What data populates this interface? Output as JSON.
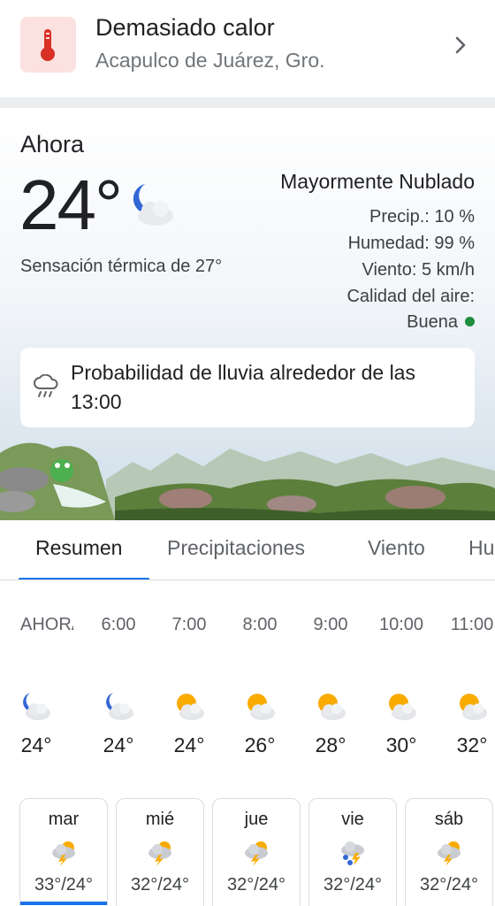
{
  "alert": {
    "title": "Demasiado calor",
    "location": "Acapulco de Juárez, Gro."
  },
  "current": {
    "label": "Ahora",
    "temperature": "24°",
    "condition": "Mayormente Nublado",
    "feels_like": "Sensación térmica de 27°",
    "precip": "Precip.: 10 %",
    "humidity": "Humedad: 99 %",
    "wind": "Viento: 5 km/h",
    "air_quality_label": "Calidad del aire:",
    "air_quality_value": "Buena"
  },
  "rain_notice": "Probabilidad de lluvia alrededor de las 13:00",
  "tabs": [
    {
      "label": "Resumen",
      "active": true
    },
    {
      "label": "Precipitaciones"
    },
    {
      "label": "Viento"
    },
    {
      "label": "Humedad"
    }
  ],
  "hourly": [
    {
      "time": "AHORA",
      "temp": "24°",
      "icon": "moon-cloud"
    },
    {
      "time": "6:00",
      "temp": "24°",
      "icon": "moon-cloud"
    },
    {
      "time": "7:00",
      "temp": "24°",
      "icon": "sun-cloud"
    },
    {
      "time": "8:00",
      "temp": "26°",
      "icon": "sun-cloud"
    },
    {
      "time": "9:00",
      "temp": "28°",
      "icon": "sun-cloud"
    },
    {
      "time": "10:00",
      "temp": "30°",
      "icon": "sun-cloud"
    },
    {
      "time": "11:00",
      "temp": "32°",
      "icon": "sun-cloud"
    }
  ],
  "daily": [
    {
      "day": "mar",
      "range": "33°/24°",
      "icon": "thunderstorm",
      "selected": true
    },
    {
      "day": "mié",
      "range": "32°/24°",
      "icon": "thunderstorm"
    },
    {
      "day": "jue",
      "range": "32°/24°",
      "icon": "thunderstorm"
    },
    {
      "day": "vie",
      "range": "32°/24°",
      "icon": "thunderstorm-rain"
    },
    {
      "day": "sáb",
      "range": "32°/24°",
      "icon": "thunderstorm"
    }
  ],
  "colors": {
    "accent": "#1a73e8",
    "alert_bg": "#fbe1e0",
    "alert_icon": "#d93025",
    "air_good": "#1e8e3e"
  }
}
